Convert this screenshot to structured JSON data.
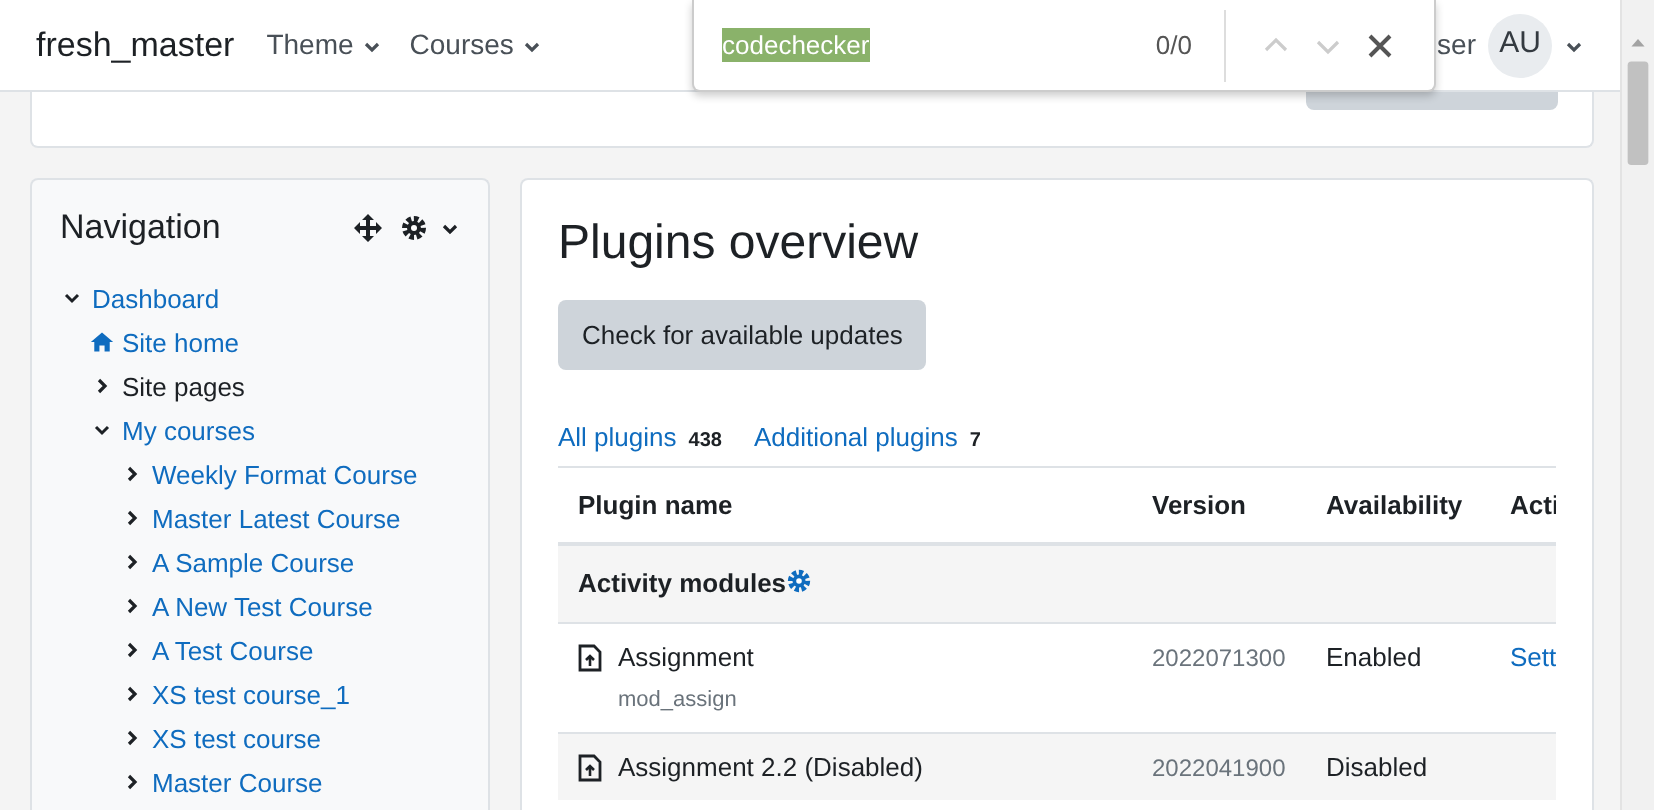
{
  "navbar": {
    "brand": "fresh_master",
    "menus": [
      {
        "label": "Theme"
      },
      {
        "label": "Courses"
      }
    ],
    "user_name": "ser",
    "avatar": "AU"
  },
  "find_bar": {
    "query": "codechecker",
    "count": "0/0"
  },
  "navigation": {
    "title": "Navigation",
    "tree": [
      {
        "label": "Dashboard",
        "kind": "branch",
        "link": true,
        "expanded": true,
        "children": [
          {
            "label": "Site home",
            "kind": "home",
            "link": true
          },
          {
            "label": "Site pages",
            "kind": "branch",
            "link": false,
            "expanded": false
          },
          {
            "label": "My courses",
            "kind": "branch",
            "link": true,
            "expanded": true,
            "children": [
              {
                "label": "Weekly Format Course",
                "kind": "branch",
                "link": true,
                "expanded": false
              },
              {
                "label": "Master Latest Course",
                "kind": "branch",
                "link": true,
                "expanded": false
              },
              {
                "label": "A Sample Course",
                "kind": "branch",
                "link": true,
                "expanded": false
              },
              {
                "label": "A New Test Course",
                "kind": "branch",
                "link": true,
                "expanded": false
              },
              {
                "label": "A Test Course",
                "kind": "branch",
                "link": true,
                "expanded": false
              },
              {
                "label": "XS test course_1",
                "kind": "branch",
                "link": true,
                "expanded": false
              },
              {
                "label": "XS test course",
                "kind": "branch",
                "link": true,
                "expanded": false
              },
              {
                "label": "Master Course",
                "kind": "branch",
                "link": true,
                "expanded": false
              }
            ]
          }
        ]
      }
    ]
  },
  "main": {
    "title": "Plugins overview",
    "update_button": "Check for available updates",
    "filters": [
      {
        "label": "All plugins",
        "count": "438"
      },
      {
        "label": "Additional plugins",
        "count": "7"
      }
    ],
    "table": {
      "columns": [
        "Plugin name",
        "Version",
        "Availability",
        "Acti"
      ],
      "rows": [
        {
          "kind": "group",
          "name": "Activity modules"
        },
        {
          "kind": "plugin",
          "name": "Assignment",
          "component": "mod_assign",
          "version": "2022071300",
          "availability": "Enabled",
          "action": "Sett"
        },
        {
          "kind": "plugin",
          "name": "Assignment 2.2 (Disabled)",
          "version": "2022041900",
          "availability": "Disabled"
        }
      ]
    }
  }
}
